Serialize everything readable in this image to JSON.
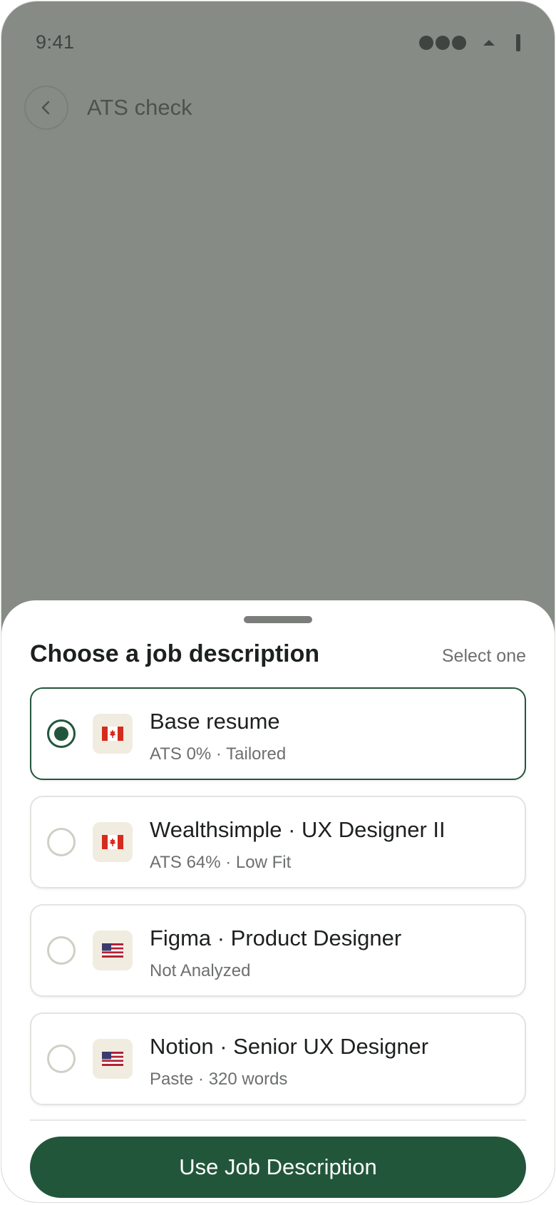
{
  "status_bar": {
    "time": "9:41"
  },
  "header": {
    "title": "ATS check",
    "back_icon": "chevron-left-icon"
  },
  "sheet": {
    "title": "Choose a job description",
    "hint": "Select one",
    "options": [
      {
        "title": "Base resume",
        "subtitle": "ATS 0% · Tailored",
        "flag": "canada-flag-icon",
        "selected": true
      },
      {
        "title": "Wealthsimple · UX Designer II",
        "subtitle": "ATS 64% · Low Fit",
        "flag": "canada-flag-icon",
        "selected": false
      },
      {
        "title": "Figma · Product Designer",
        "subtitle": "Not Analyzed",
        "flag": "us-flag-icon",
        "selected": false
      },
      {
        "title": "Notion · Senior UX Designer",
        "subtitle": "Paste · 320 words",
        "flag": "us-flag-icon",
        "selected": false
      }
    ],
    "cta_label": "Use Job Description"
  },
  "colors": {
    "accent": "#22563a",
    "scrim": "#878b86",
    "flag_tile": "#f1ece0"
  }
}
